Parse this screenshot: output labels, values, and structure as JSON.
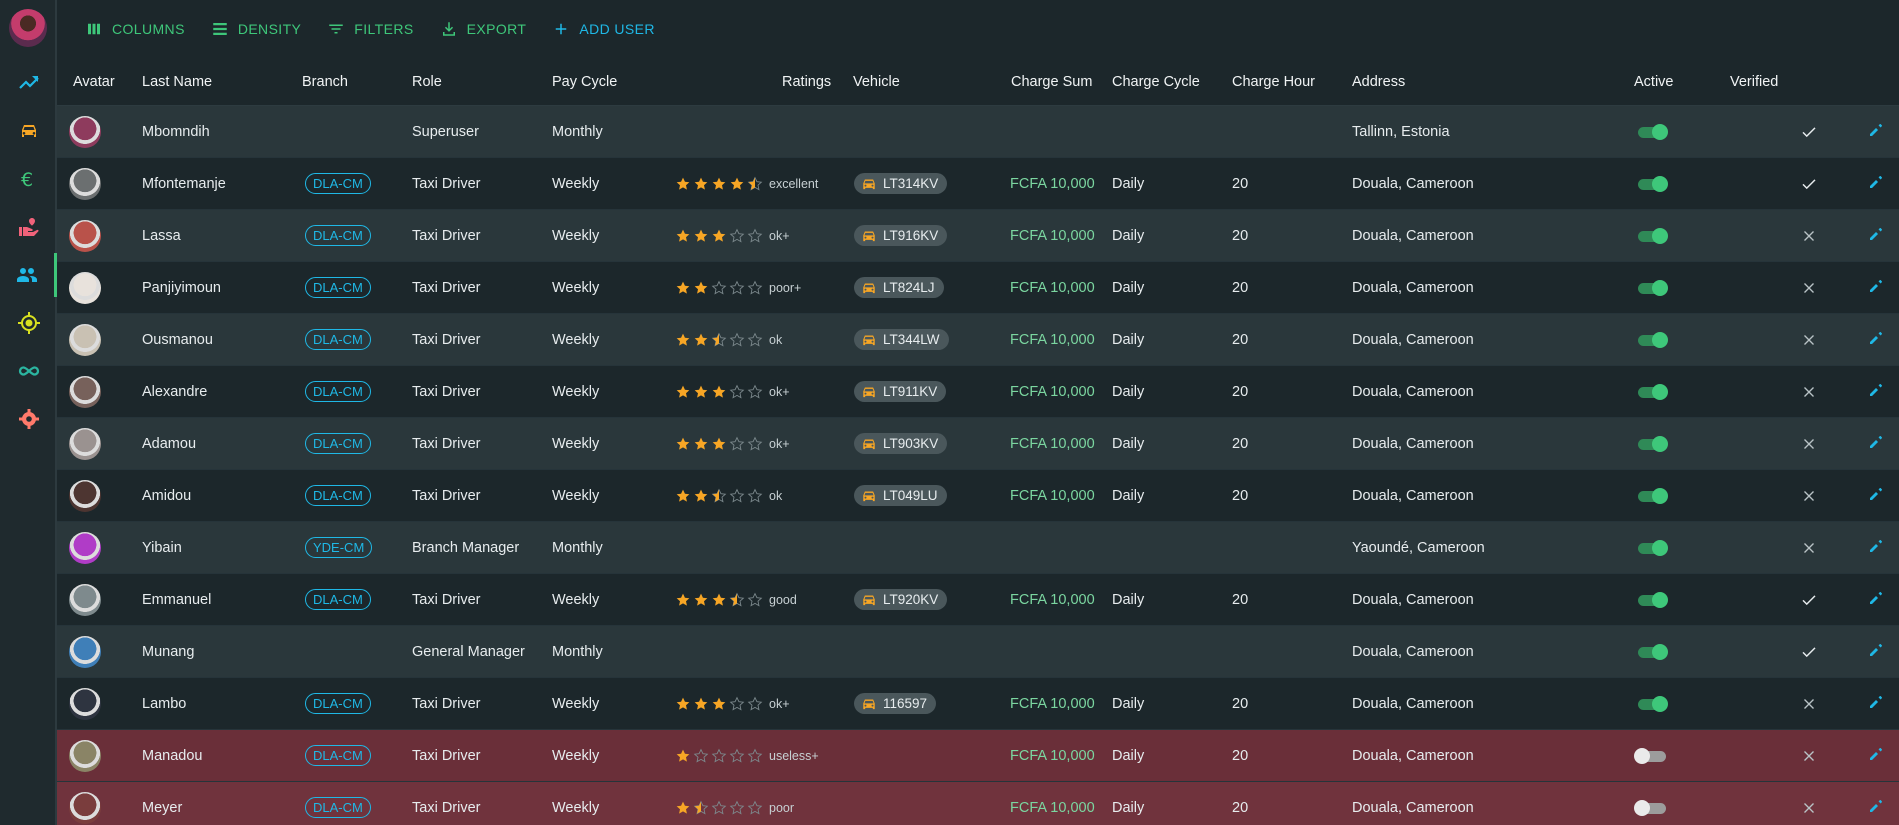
{
  "toolbar": {
    "columns": "COLUMNS",
    "density": "DENSITY",
    "filters": "FILTERS",
    "export": "EXPORT",
    "add_user": "ADD USER"
  },
  "sidebar": {
    "items": [
      "analytics-icon",
      "car-icon",
      "euro-icon",
      "volunteer-icon",
      "people-icon",
      "location-icon",
      "infinity-icon",
      "settings-icon"
    ],
    "active": 4
  },
  "columns": {
    "avatar": "Avatar",
    "last_name": "Last Name",
    "branch": "Branch",
    "role": "Role",
    "pay_cycle": "Pay Cycle",
    "ratings": "Ratings",
    "vehicle": "Vehicle",
    "charge_sum": "Charge Sum",
    "charge_cycle": "Charge Cycle",
    "charge_hour": "Charge Hour",
    "address": "Address",
    "active": "Active",
    "verified": "Verified"
  },
  "colors": {
    "star": "#f7a625",
    "green": "#3ec77a",
    "cyan": "#1fb8e6",
    "delete": "#f0627a",
    "settings": "#ff7a6b"
  },
  "rows": [
    {
      "last_name": "Mbomndih",
      "branch": "",
      "role": "Superuser",
      "pay_cycle": "Monthly",
      "stars": null,
      "rating": "",
      "vehicle": "",
      "charge_sum": "",
      "charge_cycle": "",
      "charge_hour": "",
      "address": "Tallinn, Estonia",
      "active": true,
      "verified": true,
      "avatar": "#8e3b5d"
    },
    {
      "last_name": "Mfontemanje",
      "branch": "DLA-CM",
      "role": "Taxi Driver",
      "pay_cycle": "Weekly",
      "stars": 4.5,
      "rating": "excellent",
      "vehicle": "LT314KV",
      "charge_sum": "FCFA 10,000",
      "charge_cycle": "Daily",
      "charge_hour": "20",
      "address": "Douala, Cameroon",
      "active": true,
      "verified": true,
      "avatar": "#6b6f70"
    },
    {
      "last_name": "Lassa",
      "branch": "DLA-CM",
      "role": "Taxi Driver",
      "pay_cycle": "Weekly",
      "stars": 3,
      "rating": "ok+",
      "vehicle": "LT916KV",
      "charge_sum": "FCFA 10,000",
      "charge_cycle": "Daily",
      "charge_hour": "20",
      "address": "Douala, Cameroon",
      "active": true,
      "verified": false,
      "avatar": "#b9524a"
    },
    {
      "last_name": "Panjiyimoun",
      "branch": "DLA-CM",
      "role": "Taxi Driver",
      "pay_cycle": "Weekly",
      "stars": 2,
      "rating": "poor+",
      "vehicle": "LT824LJ",
      "charge_sum": "FCFA 10,000",
      "charge_cycle": "Daily",
      "charge_hour": "20",
      "address": "Douala, Cameroon",
      "active": true,
      "verified": false,
      "avatar": "#e8e2dc"
    },
    {
      "last_name": "Ousmanou",
      "branch": "DLA-CM",
      "role": "Taxi Driver",
      "pay_cycle": "Weekly",
      "stars": 2.5,
      "rating": "ok",
      "vehicle": "LT344LW",
      "charge_sum": "FCFA 10,000",
      "charge_cycle": "Daily",
      "charge_hour": "20",
      "address": "Douala, Cameroon",
      "active": true,
      "verified": false,
      "avatar": "#c9c1b3"
    },
    {
      "last_name": "Alexandre",
      "branch": "DLA-CM",
      "role": "Taxi Driver",
      "pay_cycle": "Weekly",
      "stars": 3,
      "rating": "ok+",
      "vehicle": "LT911KV",
      "charge_sum": "FCFA 10,000",
      "charge_cycle": "Daily",
      "charge_hour": "20",
      "address": "Douala, Cameroon",
      "active": true,
      "verified": false,
      "avatar": "#77615b"
    },
    {
      "last_name": "Adamou",
      "branch": "DLA-CM",
      "role": "Taxi Driver",
      "pay_cycle": "Weekly",
      "stars": 3,
      "rating": "ok+",
      "vehicle": "LT903KV",
      "charge_sum": "FCFA 10,000",
      "charge_cycle": "Daily",
      "charge_hour": "20",
      "address": "Douala, Cameroon",
      "active": true,
      "verified": false,
      "avatar": "#9a9290"
    },
    {
      "last_name": "Amidou",
      "branch": "DLA-CM",
      "role": "Taxi Driver",
      "pay_cycle": "Weekly",
      "stars": 2.5,
      "rating": "ok",
      "vehicle": "LT049LU",
      "charge_sum": "FCFA 10,000",
      "charge_cycle": "Daily",
      "charge_hour": "20",
      "address": "Douala, Cameroon",
      "active": true,
      "verified": false,
      "avatar": "#4d3531"
    },
    {
      "last_name": "Yibain",
      "branch": "YDE-CM",
      "role": "Branch Manager",
      "pay_cycle": "Monthly",
      "stars": null,
      "rating": "",
      "vehicle": "",
      "charge_sum": "",
      "charge_cycle": "",
      "charge_hour": "",
      "address": "Yaoundé, Cameroon",
      "active": true,
      "verified": false,
      "avatar": "#b03cc7"
    },
    {
      "last_name": "Emmanuel",
      "branch": "DLA-CM",
      "role": "Taxi Driver",
      "pay_cycle": "Weekly",
      "stars": 3.5,
      "rating": "good",
      "vehicle": "LT920KV",
      "charge_sum": "FCFA 10,000",
      "charge_cycle": "Daily",
      "charge_hour": "20",
      "address": "Douala, Cameroon",
      "active": true,
      "verified": true,
      "avatar": "#7e8a8d"
    },
    {
      "last_name": "Munang",
      "branch": "",
      "role": "General Manager",
      "pay_cycle": "Monthly",
      "stars": null,
      "rating": "",
      "vehicle": "",
      "charge_sum": "",
      "charge_cycle": "",
      "charge_hour": "",
      "address": "Douala, Cameroon",
      "active": true,
      "verified": true,
      "avatar": "#3f7fb8"
    },
    {
      "last_name": "Lambo",
      "branch": "DLA-CM",
      "role": "Taxi Driver",
      "pay_cycle": "Weekly",
      "stars": 3,
      "rating": "ok+",
      "vehicle": "116597",
      "charge_sum": "FCFA 10,000",
      "charge_cycle": "Daily",
      "charge_hour": "20",
      "address": "Douala, Cameroon",
      "active": true,
      "verified": false,
      "avatar": "#2e3440"
    },
    {
      "last_name": "Manadou",
      "branch": "DLA-CM",
      "role": "Taxi Driver",
      "pay_cycle": "Weekly",
      "stars": 1,
      "rating": "useless+",
      "vehicle": "",
      "charge_sum": "FCFA 10,000",
      "charge_cycle": "Daily",
      "charge_hour": "20",
      "address": "Douala, Cameroon",
      "active": false,
      "verified": false,
      "avatar": "#8a8466"
    },
    {
      "last_name": "Meyer",
      "branch": "DLA-CM",
      "role": "Taxi Driver",
      "pay_cycle": "Weekly",
      "stars": 1.5,
      "rating": "poor",
      "vehicle": "",
      "charge_sum": "FCFA 10,000",
      "charge_cycle": "Daily",
      "charge_hour": "20",
      "address": "Douala, Cameroon",
      "active": false,
      "verified": false,
      "avatar": "#7a3d3d"
    }
  ]
}
